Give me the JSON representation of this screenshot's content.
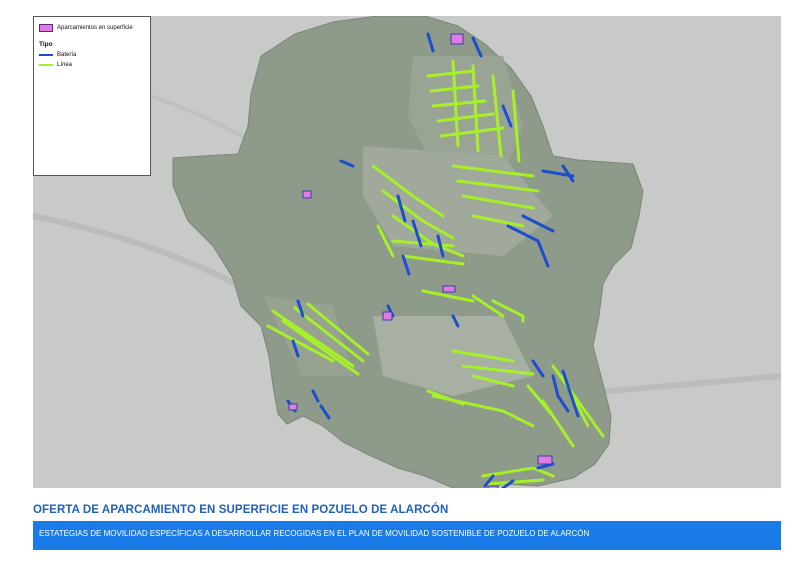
{
  "legend": {
    "area_label": "Aparcamientos en superficie",
    "type_heading": "Tipo",
    "items": [
      {
        "label": "Batería",
        "color": "#1b4fcf"
      },
      {
        "label": "Línea",
        "color": "#a6f02a"
      }
    ],
    "area_fill": "#e07be0"
  },
  "title": "OFERTA DE APARCAMIENTO EN SUPERFICIE EN POZUELO DE ALARCÓN",
  "banner": {
    "text": "ESTATEGIAS DE MOVILIDAD ESPECÍFICAS A DESARROLLAR RECOGIDAS EN EL PLAN DE MOVILIDAD SOSTENIBLE DE POZUELO DE ALARCÓN",
    "color": "#1a7be8"
  },
  "colors": {
    "title": "#1f5fbf",
    "municipality": "#8e9a8a",
    "background_map": "#c9cbc9"
  }
}
